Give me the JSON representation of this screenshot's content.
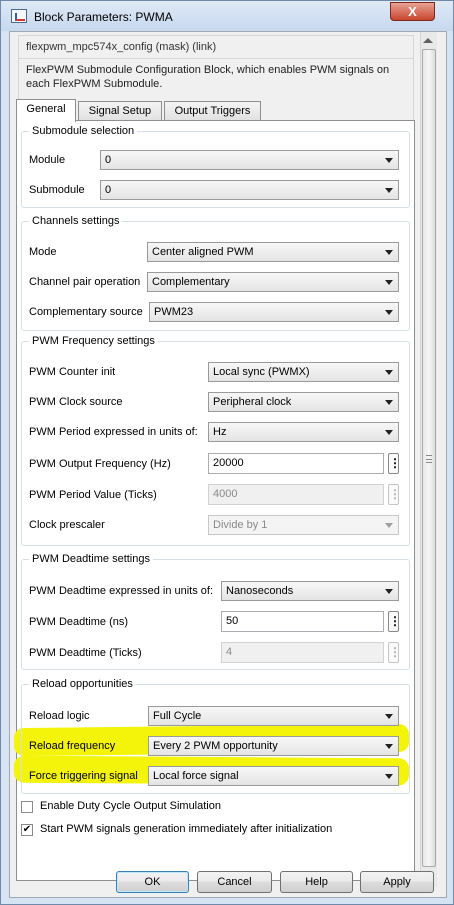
{
  "window": {
    "title": "Block Parameters: PWMA",
    "close_symbol": "X"
  },
  "description": {
    "header": "flexpwm_mpc574x_config (mask) (link)",
    "text": "FlexPWM Submodule Configuration Block, which enables PWM signals on each FlexPWM Submodule."
  },
  "tabs": [
    {
      "label": "General",
      "active": true
    },
    {
      "label": "Signal Setup",
      "active": false
    },
    {
      "label": "Output Triggers",
      "active": false
    }
  ],
  "submodule_selection": {
    "legend": "Submodule selection",
    "module_label": "Module",
    "module_value": "0",
    "submodule_label": "Submodule",
    "submodule_value": "0"
  },
  "channels": {
    "legend": "Channels settings",
    "mode_label": "Mode",
    "mode_value": "Center aligned PWM",
    "pair_label": "Channel pair operation",
    "pair_value": "Complementary",
    "comp_source_label": "Complementary source",
    "comp_source_value": "PWM23"
  },
  "pwm_frequency": {
    "legend": "PWM Frequency settings",
    "counter_init_label": "PWM Counter init",
    "counter_init_value": "Local sync (PWMX)",
    "clock_source_label": "PWM Clock source",
    "clock_source_value": "Peripheral clock",
    "period_units_label": "PWM Period expressed in units of:",
    "period_units_value": "Hz",
    "output_freq_label": "PWM Output Frequency (Hz)",
    "output_freq_value": "20000",
    "period_ticks_label": "PWM Period Value (Ticks)",
    "period_ticks_value": "4000",
    "prescaler_label": "Clock prescaler",
    "prescaler_value": "Divide by 1"
  },
  "deadtime": {
    "legend": "PWM Deadtime settings",
    "units_label": "PWM Deadtime expressed in units of:",
    "units_value": "Nanoseconds",
    "ns_label": "PWM Deadtime (ns)",
    "ns_value": "50",
    "ticks_label": "PWM Deadtime (Ticks)",
    "ticks_value": "4"
  },
  "reload": {
    "legend": "Reload opportunities",
    "logic_label": "Reload logic",
    "logic_value": "Full Cycle",
    "frequency_label": "Reload frequency",
    "frequency_value": "Every 2 PWM opportunity",
    "force_label": "Force triggering signal",
    "force_value": "Local force signal",
    "highlight_color": "#f4f40a"
  },
  "checkboxes": {
    "duty_cycle_label": "Enable Duty Cycle Output Simulation",
    "duty_cycle_checked": false,
    "start_pwm_label": "Start PWM signals generation immediately after initialization",
    "start_pwm_checked": true,
    "check_mark": "✔"
  },
  "kebab_symbol": "⋮",
  "buttons": {
    "ok": "OK",
    "cancel": "Cancel",
    "help": "Help",
    "apply": "Apply"
  }
}
